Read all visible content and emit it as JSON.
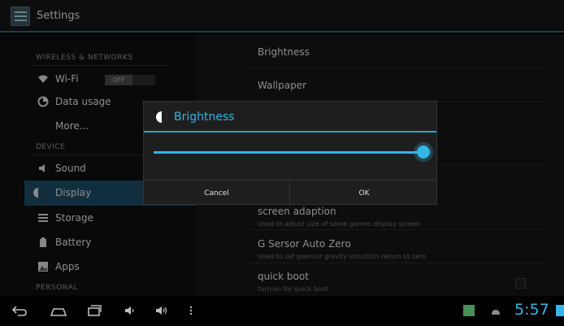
{
  "app": {
    "title": "Settings"
  },
  "left_nav": {
    "section_wireless": "WIRELESS & NETWORKS",
    "section_device": "DEVICE",
    "section_personal": "PERSONAL",
    "items": [
      {
        "label": "Wi-Fi",
        "icon": "wifi-icon"
      },
      {
        "label": "Data usage",
        "icon": "data-usage-icon"
      },
      {
        "label": "More...",
        "icon": ""
      },
      {
        "label": "Sound",
        "icon": "speaker-icon"
      },
      {
        "label": "Display",
        "icon": "brightness-icon"
      },
      {
        "label": "Storage",
        "icon": "storage-icon"
      },
      {
        "label": "Battery",
        "icon": "battery-icon"
      },
      {
        "label": "Apps",
        "icon": "apps-icon"
      }
    ],
    "wifi_toggle": "OFF"
  },
  "right_pane": {
    "items": [
      {
        "title": "Brightness"
      },
      {
        "title": "Wallpaper"
      },
      {
        "title": "screen adaption",
        "subtitle": "Used to adjust size of some games display screen"
      },
      {
        "title": "G Sersor Auto Zero",
        "subtitle": "Used to set gsensor gravity induction return to zero"
      },
      {
        "title": "quick boot",
        "subtitle": "turn on for quick boot"
      }
    ]
  },
  "dialog": {
    "title": "Brightness",
    "brightness_level": 1.0,
    "cancel_label": "Cancel",
    "ok_label": "OK"
  },
  "status": {
    "clock": "5:57"
  },
  "colors": {
    "accent": "#33b5e5",
    "selected": "#19485f"
  }
}
